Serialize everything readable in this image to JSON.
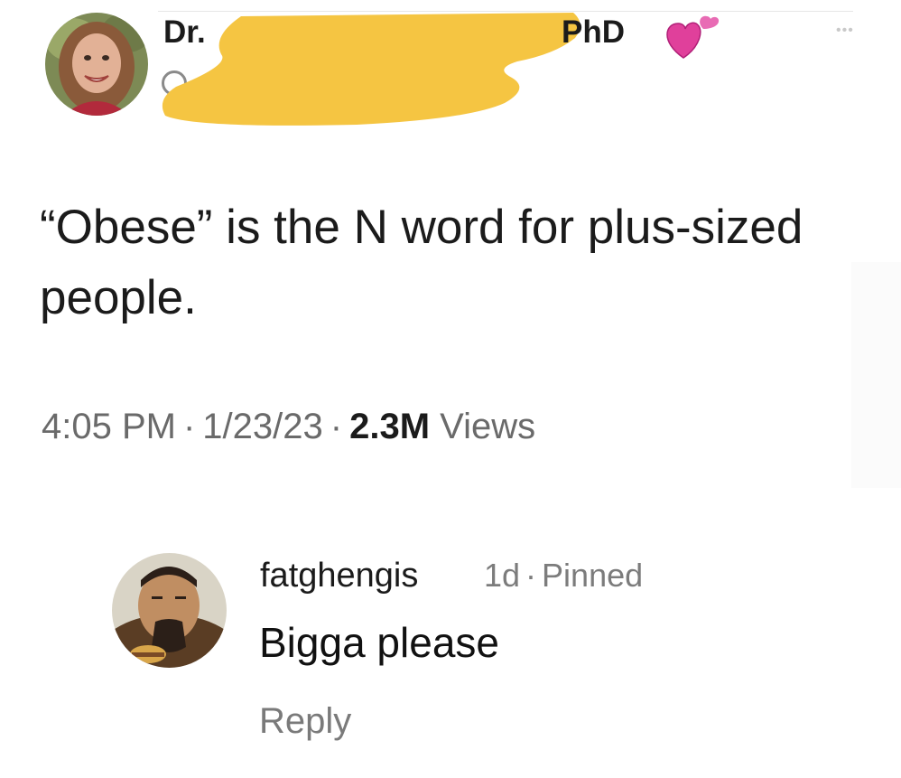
{
  "tweet": {
    "author_name_prefix": "Dr.",
    "author_name_suffix": "PhD",
    "name_emoji": "heart-icon",
    "redaction_color": "#f5c542",
    "more_icon": "more-options-icon",
    "text": "“Obese” is the N word for plus-sized people.",
    "time": "4:05 PM",
    "date": "1/23/23",
    "views_count": "2.3M",
    "views_label": "Views",
    "separator": "·"
  },
  "comment": {
    "username": "fatghengis",
    "age": "1d",
    "pinned_label": "Pinned",
    "separator": "·",
    "text": "Bigga please",
    "reply_label": "Reply"
  },
  "colors": {
    "text_primary": "#1b1b1b",
    "text_secondary": "#6a6a6a",
    "heart": "#e0409b",
    "redaction": "#f5c542"
  }
}
